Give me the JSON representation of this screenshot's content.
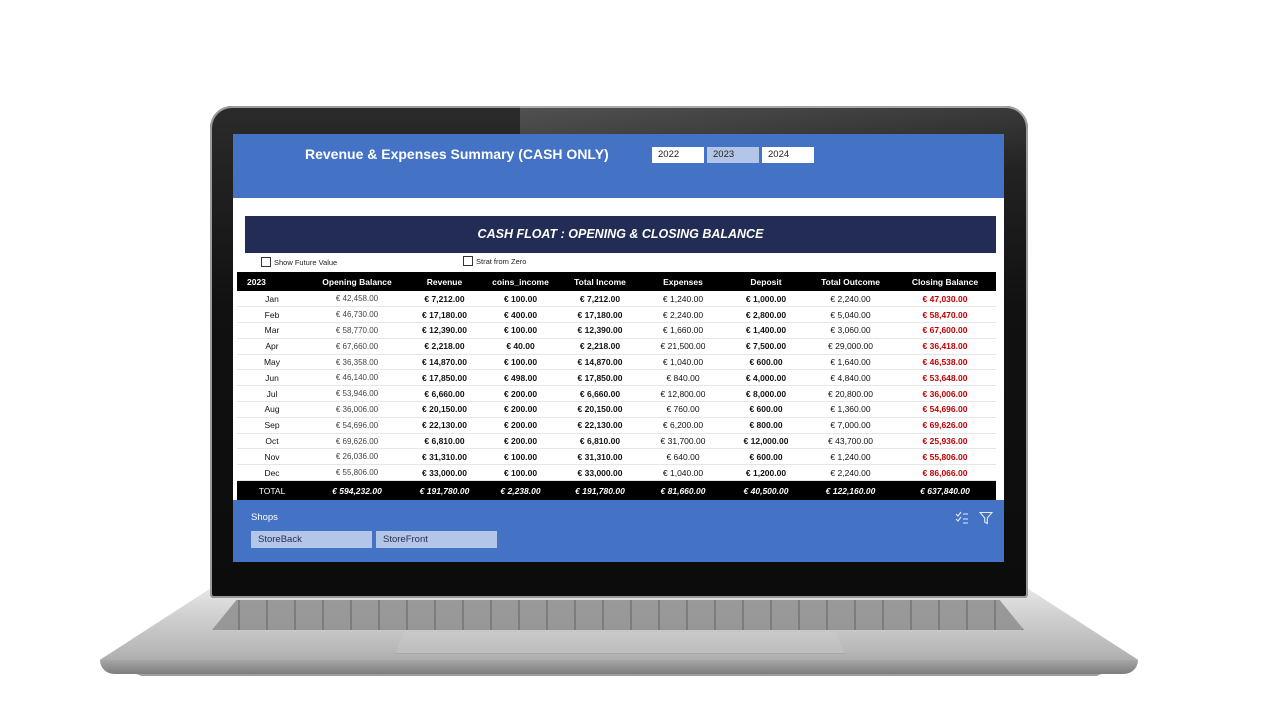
{
  "header": {
    "title": "Revenue & Expenses Summary (CASH ONLY)",
    "years": [
      {
        "label": "2022",
        "selected": false
      },
      {
        "label": "2023",
        "selected": true
      },
      {
        "label": "2024",
        "selected": false
      }
    ]
  },
  "card": {
    "title": "CASH FLOAT : OPENING & CLOSING BALANCE",
    "toggles": {
      "future": "Show Future Value",
      "zero": "Strat from Zero"
    }
  },
  "table": {
    "columns": [
      "2023",
      "Opening  Balance",
      "Revenue",
      "coins_income",
      "Total Income",
      "Expenses",
      "Deposit",
      "Total Outcome",
      "Closing  Balance"
    ],
    "rows": [
      [
        "Jan",
        "€ 42,458.00",
        "€ 7,212.00",
        "€ 100.00",
        "€ 7,212.00",
        "€ 1,240.00",
        "€ 1,000.00",
        "€ 2,240.00",
        "€ 47,030.00"
      ],
      [
        "Feb",
        "€ 46,730.00",
        "€ 17,180.00",
        "€ 400.00",
        "€ 17,180.00",
        "€ 2,240.00",
        "€ 2,800.00",
        "€ 5,040.00",
        "€ 58,470.00"
      ],
      [
        "Mar",
        "€ 58,770.00",
        "€ 12,390.00",
        "€ 100.00",
        "€ 12,390.00",
        "€ 1,660.00",
        "€ 1,400.00",
        "€ 3,060.00",
        "€ 67,600.00"
      ],
      [
        "Apr",
        "€ 67,660.00",
        "€ 2,218.00",
        "€ 40.00",
        "€ 2,218.00",
        "€ 21,500.00",
        "€ 7,500.00",
        "€ 29,000.00",
        "€ 36,418.00"
      ],
      [
        "May",
        "€ 36,358.00",
        "€ 14,870.00",
        "€ 100.00",
        "€ 14,870.00",
        "€ 1,040.00",
        "€ 600.00",
        "€ 1,640.00",
        "€ 46,538.00"
      ],
      [
        "Jun",
        "€ 46,140.00",
        "€ 17,850.00",
        "€ 498.00",
        "€ 17,850.00",
        "€ 840.00",
        "€ 4,000.00",
        "€ 4,840.00",
        "€ 53,648.00"
      ],
      [
        "Jul",
        "€ 53,946.00",
        "€ 6,660.00",
        "€ 200.00",
        "€ 6,660.00",
        "€ 12,800.00",
        "€ 8,000.00",
        "€ 20,800.00",
        "€ 36,006.00"
      ],
      [
        "Aug",
        "€ 36,006.00",
        "€ 20,150.00",
        "€ 200.00",
        "€ 20,150.00",
        "€ 760.00",
        "€ 600.00",
        "€ 1,360.00",
        "€ 54,696.00"
      ],
      [
        "Sep",
        "€ 54,696.00",
        "€ 22,130.00",
        "€ 200.00",
        "€ 22,130.00",
        "€ 6,200.00",
        "€ 800.00",
        "€ 7,000.00",
        "€ 69,626.00"
      ],
      [
        "Oct",
        "€ 69,626.00",
        "€ 6,810.00",
        "€ 200.00",
        "€ 6,810.00",
        "€ 31,700.00",
        "€ 12,000.00",
        "€ 43,700.00",
        "€ 25,936.00"
      ],
      [
        "Nov",
        "€ 26,036.00",
        "€ 31,310.00",
        "€ 100.00",
        "€ 31,310.00",
        "€ 640.00",
        "€ 600.00",
        "€ 1,240.00",
        "€ 55,806.00"
      ],
      [
        "Dec",
        "€ 55,806.00",
        "€ 33,000.00",
        "€ 100.00",
        "€ 33,000.00",
        "€ 1,040.00",
        "€ 1,200.00",
        "€ 2,240.00",
        "€ 86,066.00"
      ]
    ],
    "total": [
      "TOTAL",
      "€ 594,232.00",
      "€ 191,780.00",
      "€ 2,238.00",
      "€ 191,780.00",
      "€ 81,660.00",
      "€ 40,500.00",
      "€ 122,160.00",
      "€ 637,840.00"
    ]
  },
  "shops": {
    "title": "Shops",
    "items": [
      "StoreBack",
      "StoreFront"
    ],
    "icons": [
      "clear-selections-icon",
      "filter-icon"
    ]
  },
  "colors": {
    "accent": "#4472c4",
    "header_dark": "#222c54",
    "selected": "#b4c6e7",
    "closing_red": "#c00000"
  }
}
